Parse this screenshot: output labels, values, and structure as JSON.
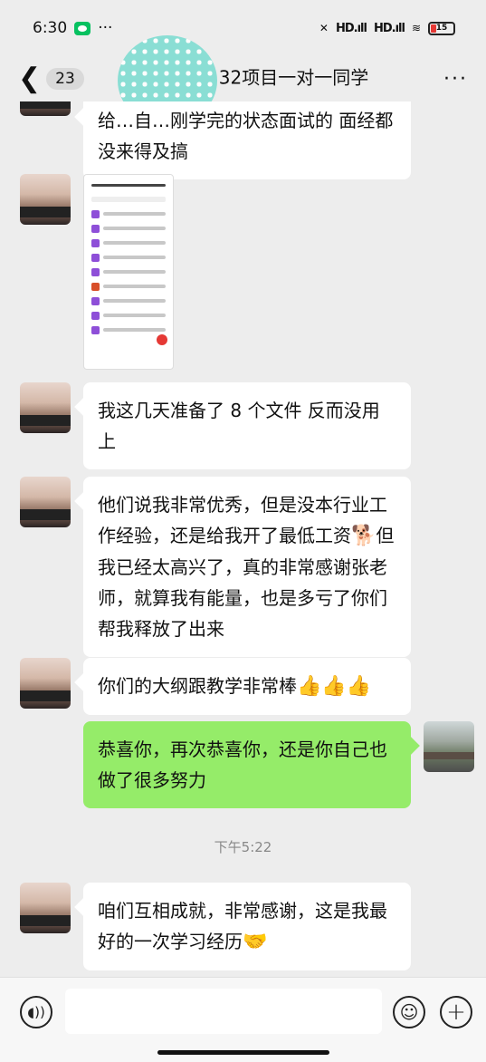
{
  "status_bar": {
    "time": "6:30",
    "dots": "···",
    "signal_1": "HD.ıll",
    "signal_2": "HD.ıll",
    "wifi": "≋",
    "battery": "15"
  },
  "nav": {
    "back_symbol": "❮",
    "unread_count": "23",
    "title": "32项目一对一同学",
    "more_symbol": "···"
  },
  "messages": [
    {
      "side": "them",
      "text": "给…自…刚学完的状态面试的 面经都没来得及搞"
    },
    {
      "side": "them",
      "type": "image"
    },
    {
      "side": "them",
      "text": "我这几天准备了 8 个文件 反而没用上"
    },
    {
      "side": "them",
      "text_1": "他们说我非常优秀，但是没本行业工作经验，还是给我开了最低工资",
      "emoji_1": "🐕",
      "text_2": "但我已经太高兴了，真的非常感谢张老师，就算我有能量，也是多亏了你们帮我释放了出来"
    },
    {
      "side": "them",
      "text": "你们的大纲跟教学非常棒",
      "emoji": "👍👍👍"
    },
    {
      "side": "me",
      "text": "恭喜你，再次恭喜你，还是你自己也做了很多努力"
    },
    {
      "side": "them",
      "text": "咱们互相成就，非常感谢，这是我最好的一次学习经历",
      "emoji": "🤝"
    }
  ],
  "timestamp": "下午5:22",
  "input_bar": {
    "voice_symbol": "◖))",
    "emoji_symbol": "☺",
    "plus_symbol": "+"
  },
  "icons": {
    "back": "back-icon",
    "more": "more-icon",
    "voice": "voice-icon",
    "emoji": "emoji-icon",
    "plus": "plus-icon"
  },
  "colors": {
    "background": "#ededed",
    "my_bubble": "#95ec69",
    "their_bubble": "#ffffff"
  }
}
